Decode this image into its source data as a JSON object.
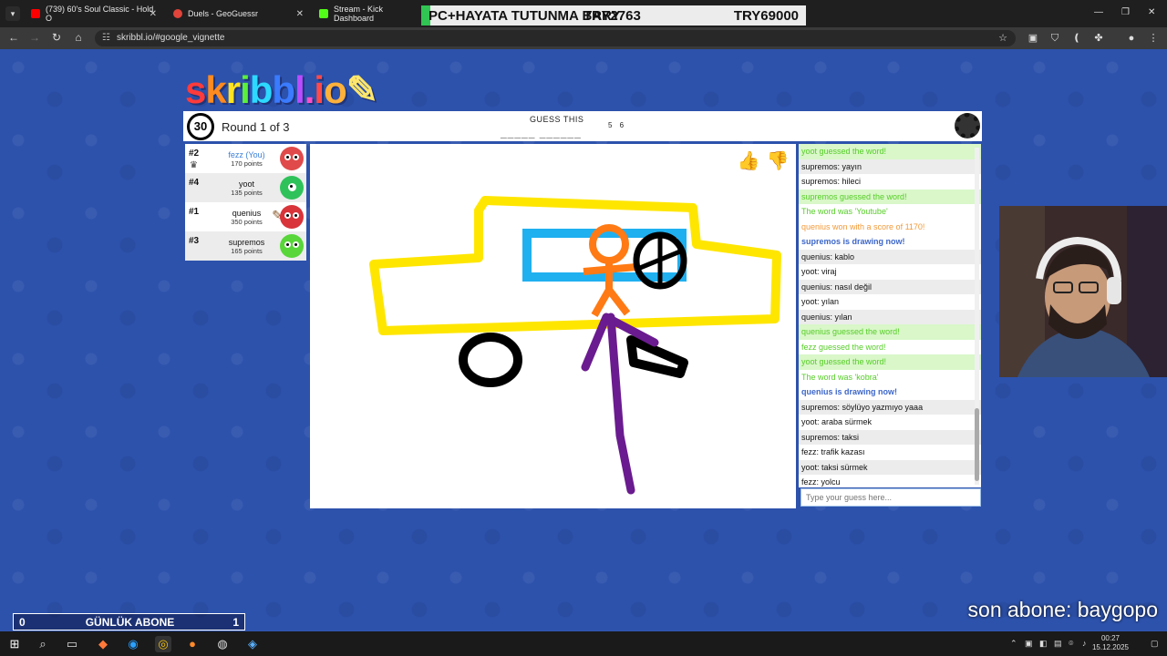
{
  "browser": {
    "tabs": [
      {
        "title": "(739) 60's Soul Classic - Hold O",
        "color": "#ff0000"
      },
      {
        "title": "Duels - GeoGuessr",
        "color": "#e0443a"
      },
      {
        "title": "Stream - Kick Dashboard",
        "color": "#53fc18"
      }
    ],
    "url": "skribbl.io/#google_vignette"
  },
  "overlay": {
    "banner_left": "PC+HAYATA TUTUNMA BARY",
    "banner_mid": "TRY2763",
    "banner_right": "TRY69000",
    "sub_left": "0",
    "sub_label": "GÜNLÜK ABONE",
    "sub_right": "1",
    "last_sub": "son abone: baygopo"
  },
  "game": {
    "logo": "skribbl.io",
    "timer": "30",
    "round": "Round 1 of 3",
    "guess_label": "GUESS THIS",
    "hint": "_____ ______",
    "hint_counts": "5 6",
    "players": [
      {
        "rank": "#2",
        "name": "fezz (You)",
        "points": "170 points",
        "you": true,
        "avatar_color": "#e04a4a"
      },
      {
        "rank": "#4",
        "name": "yoot",
        "points": "135 points",
        "you": false,
        "avatar_color": "#2fc25a"
      },
      {
        "rank": "#1",
        "name": "quenius",
        "points": "350 points",
        "you": false,
        "avatar_color": "#d8343a"
      },
      {
        "rank": "#3",
        "name": "supremos",
        "points": "165 points",
        "you": false,
        "avatar_color": "#58d63a"
      }
    ]
  },
  "chat": {
    "messages": [
      {
        "type": "green",
        "text": "yoot guessed the word!"
      },
      {
        "type": "normal",
        "user": "supremos:",
        "text": " yayın"
      },
      {
        "type": "normal",
        "user": "supremos:",
        "text": " hileci"
      },
      {
        "type": "green",
        "text": "supremos guessed the word!"
      },
      {
        "type": "green2",
        "text": "The word was 'Youtube'"
      },
      {
        "type": "orange",
        "text": "quenius won with a score of 1170!"
      },
      {
        "type": "blue",
        "text": "supremos is drawing now!"
      },
      {
        "type": "normal",
        "user": "quenius:",
        "text": " kablo"
      },
      {
        "type": "normal",
        "user": "yoot:",
        "text": " viraj"
      },
      {
        "type": "normal",
        "user": "quenius:",
        "text": " nasıl değil"
      },
      {
        "type": "normal",
        "user": "yoot:",
        "text": " yılan"
      },
      {
        "type": "normal",
        "user": "quenius:",
        "text": " yılan"
      },
      {
        "type": "green",
        "text": "quenius guessed the word!"
      },
      {
        "type": "green2",
        "text": "fezz guessed the word!"
      },
      {
        "type": "green",
        "text": "yoot guessed the word!"
      },
      {
        "type": "green2",
        "text": "The word was 'kobra'"
      },
      {
        "type": "blue",
        "text": "quenius is drawing now!"
      },
      {
        "type": "normal",
        "user": "supremos:",
        "text": " söylüyo yazmıyo yaaa"
      },
      {
        "type": "normal",
        "user": "yoot:",
        "text": " araba sürmek"
      },
      {
        "type": "normal",
        "user": "supremos:",
        "text": " taksi"
      },
      {
        "type": "normal",
        "user": "fezz:",
        "text": " trafik kazası"
      },
      {
        "type": "normal",
        "user": "yoot:",
        "text": " taksi sürmek"
      },
      {
        "type": "normal",
        "user": "fezz:",
        "text": " yolcu"
      }
    ],
    "input_placeholder": "Type your guess here..."
  },
  "taskbar": {
    "time": "00:27",
    "date": "15.12.2025"
  }
}
